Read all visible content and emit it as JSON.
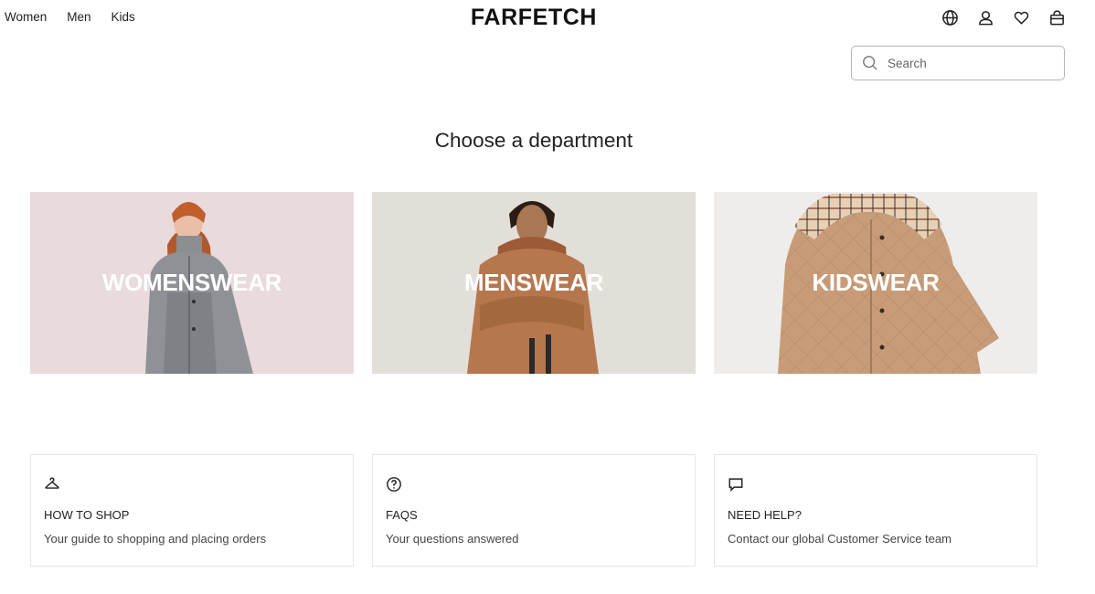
{
  "nav": {
    "women": "Women",
    "men": "Men",
    "kids": "Kids",
    "logo": "FARFETCH"
  },
  "header_icons": [
    "globe-icon",
    "account-icon",
    "wishlist-heart-icon",
    "shopping-bag-icon"
  ],
  "search": {
    "placeholder": "Search"
  },
  "page": {
    "heading": "Choose a department"
  },
  "departments": [
    {
      "label": "WOMENSWEAR",
      "bg": "#e8d9db"
    },
    {
      "label": "MENSWEAR",
      "bg": "#e1ddd7"
    },
    {
      "label": "KIDSWEAR",
      "bg": "#efedeb"
    }
  ],
  "info": [
    {
      "icon": "hanger-icon",
      "title": "HOW TO SHOP",
      "subtitle": "Your guide to shopping and placing orders"
    },
    {
      "icon": "question-circle-icon",
      "title": "FAQS",
      "subtitle": "Your questions answered"
    },
    {
      "icon": "chat-bubble-icon",
      "title": "NEED HELP?",
      "subtitle": "Contact our global Customer Service team"
    }
  ]
}
